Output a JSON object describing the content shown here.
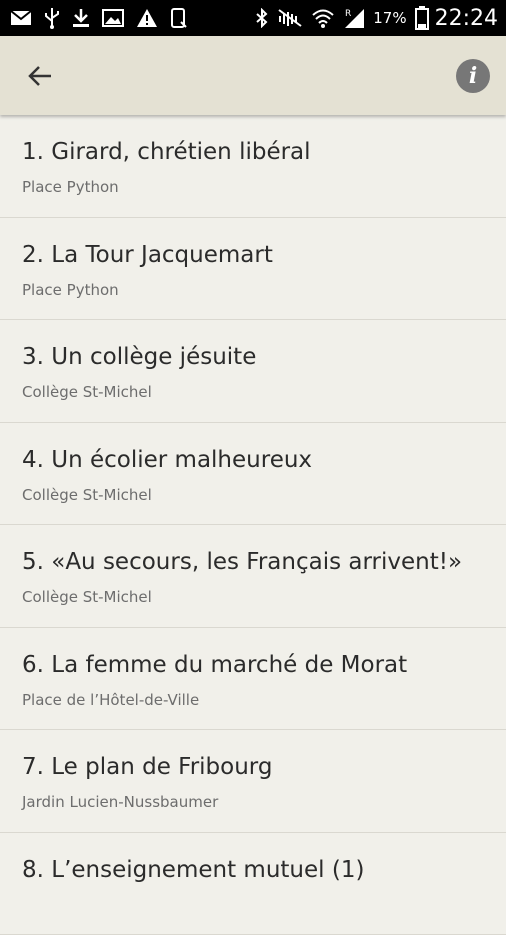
{
  "status_bar": {
    "battery_percent": "17%",
    "time": "22:24",
    "left_icons": [
      "mail-icon",
      "usb-icon",
      "download-icon",
      "image-icon",
      "warning-icon",
      "device-icon"
    ],
    "right_icons": [
      "bluetooth-icon",
      "mute-icon",
      "wifi-icon",
      "signal-icon",
      "battery-icon"
    ]
  },
  "app_bar": {
    "back_icon": "arrow-back-icon",
    "info_label": "i",
    "info_color": "#777777"
  },
  "colors": {
    "app_bar_bg": "#e4e1d3",
    "list_bg": "#f1f0ea",
    "title_text": "#2b2b2b",
    "subtitle_text": "#6d6d6d"
  },
  "items": [
    {
      "title": "1. Girard, chrétien libéral",
      "subtitle": "Place Python"
    },
    {
      "title": "2. La Tour Jacquemart",
      "subtitle": "Place Python"
    },
    {
      "title": "3. Un collège jésuite",
      "subtitle": "Collège St-Michel"
    },
    {
      "title": "4. Un écolier malheureux",
      "subtitle": "Collège St-Michel"
    },
    {
      "title": "5. «Au secours, les Français arrivent!»",
      "subtitle": "Collège St-Michel"
    },
    {
      "title": "6. La femme du marché de Morat",
      "subtitle": "Place de l’Hôtel-de-Ville"
    },
    {
      "title": "7. Le plan de Fribourg",
      "subtitle": "Jardin Lucien-Nussbaumer"
    },
    {
      "title": "8. L’enseignement mutuel (1)",
      "subtitle": ""
    }
  ]
}
